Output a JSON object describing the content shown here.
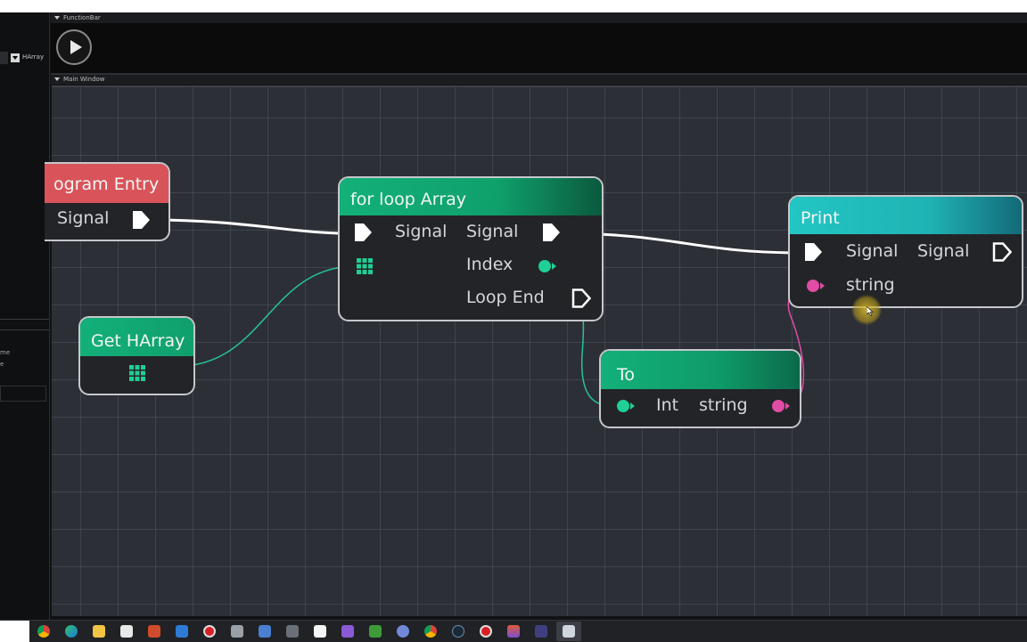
{
  "panels": {
    "function_bar_title": "FunctionBar",
    "main_window_title": "Main Window"
  },
  "left_panel": {
    "dropdown_value": "HArray",
    "text_1": "me",
    "text_2": "e"
  },
  "nodes": {
    "program_entry": {
      "title": "ogram Entry",
      "signal_out": "Signal"
    },
    "for_loop": {
      "title": "for loop Array",
      "signal_in": "Signal",
      "signal_out": "Signal",
      "index": "Index",
      "loop_end": "Loop End"
    },
    "get_harray": {
      "title": "Get HArray"
    },
    "to": {
      "title": "To",
      "input": "Int",
      "output": "string"
    },
    "print": {
      "title": "Print",
      "signal_in": "Signal",
      "signal_out": "Signal",
      "string_in": "string"
    }
  },
  "colors": {
    "entry_header": "#d8545a",
    "green_header": "#13b07a",
    "teal_header": "#20c2c0",
    "exec_pin": "#ffffff",
    "int_pin": "#1fcf95",
    "string_pin": "#e04ca6",
    "wire_exec": "#ffffff",
    "wire_int": "#27c196",
    "wire_string": "#e04ca6"
  },
  "taskbar": {
    "icons": [
      "chrome-icon",
      "edge-icon",
      "file-explorer-icon",
      "store-icon",
      "app-icon",
      "mail-icon",
      "record-icon",
      "app-icon-2",
      "people-icon",
      "calculator-icon",
      "notepad-icon",
      "visual-studio-icon",
      "minecraft-icon",
      "discord-icon",
      "chrome-icon-2",
      "steam-icon",
      "obs-icon",
      "app-icon-3",
      "terminal-icon",
      "window-icon"
    ]
  }
}
